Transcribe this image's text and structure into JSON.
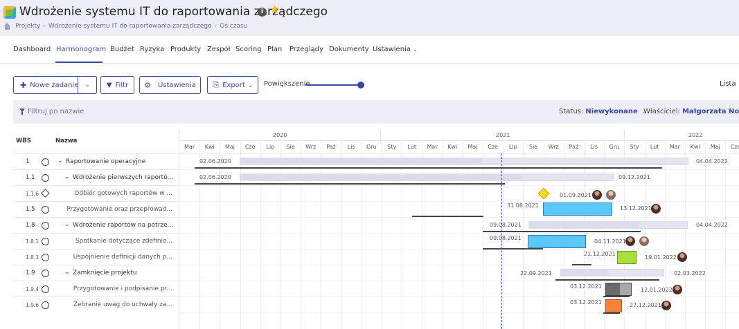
{
  "header": {
    "title": "Wdrożenie systemu IT do raportowania zarządczego",
    "breadcrumb": [
      "Projekty",
      "Wdrożenie systemu IT do raportowania zarządczego",
      "Oś czasu"
    ],
    "info_icon": "i"
  },
  "nav": {
    "items": [
      "Dashboard",
      "Harmonogram",
      "Budżet",
      "Ryzyka",
      "Produkty",
      "Zespół",
      "Scoring",
      "Plan",
      "Przeglądy",
      "Dokumenty",
      "Ustawienia"
    ],
    "active": "Harmonogram"
  },
  "toolbar": {
    "new_task": "Nowe zadanie",
    "filter": "Filtr",
    "settings": "Ustawienia",
    "export": "Export",
    "zoom_label": "Powiększenie",
    "zoom_level": 1.0,
    "list": "Lista"
  },
  "filterbar": {
    "placeholder": "Filtruj po nazwie",
    "status_label": "Status:",
    "status_value": "Niewykonane",
    "owner_label": "Właściciel:",
    "owner_value": "Małgorzata Nowak"
  },
  "grid": {
    "col_wbs": "WBS",
    "col_name": "Nazwa",
    "rows": [
      {
        "wbs": "1",
        "name": "Raportowanie operacyjne",
        "level": 0,
        "type": "group"
      },
      {
        "wbs": "1.1",
        "name": "Wdrożenie pierwszych raportó...",
        "level": 1,
        "type": "group"
      },
      {
        "wbs": "1.1.6",
        "name": "Odbiór gotowych raportów w ...",
        "level": 2,
        "type": "milestone"
      },
      {
        "wbs": "1.5",
        "name": "Przygotowanie oraz przeprowad...",
        "level": 2,
        "type": "task"
      },
      {
        "wbs": "1.8",
        "name": "Wdrożenie raportów na potrze...",
        "level": 1,
        "type": "group"
      },
      {
        "wbs": "1.8.1",
        "name": "Spotkanie dotyczące zdefinio...",
        "level": 2,
        "type": "task"
      },
      {
        "wbs": "1.8.3",
        "name": "Uspójnienie definicji danych p...",
        "level": 2,
        "type": "task"
      },
      {
        "wbs": "1.9",
        "name": "Zamknięcie projektu",
        "level": 1,
        "type": "group"
      },
      {
        "wbs": "1.9.4",
        "name": "Przygotowanie i podpisanie pr...",
        "level": 2,
        "type": "task"
      },
      {
        "wbs": "1.9.6",
        "name": "Zebranie uwag do uchwały za...",
        "level": 2,
        "type": "task"
      }
    ]
  },
  "timeline": {
    "years": [
      "2020",
      "2021",
      "2022"
    ],
    "months": [
      "Mar",
      "Kwi",
      "Maj",
      "Cze",
      "Lip",
      "Sie",
      "Wrz",
      "Paź",
      "Lis",
      "Gru",
      "Sty",
      "Lut",
      "Mar",
      "Kwi",
      "Maj",
      "Cze",
      "Lip",
      "Sie",
      "Wrz",
      "Paź",
      "Lis",
      "Gru",
      "Sty",
      "Lut",
      "Mar",
      "Kwi",
      "Maj",
      "Cze"
    ],
    "labels": {
      "r1_start": "02.06.2020",
      "r1_end": "04.04.2022",
      "r2_start": "02.06.2020",
      "r2_end": "09.12.2021",
      "r3_date": "01.09.2021",
      "r4_start": "31.08.2021",
      "r4_end": "13.12.2021",
      "r5_start": "09.08.2021",
      "r5_end": "04.04.2022",
      "r6_start": "09.08.2021",
      "r6_end": "04.11.2021",
      "r7_start": "21.12.2021",
      "r7_end": "19.01.2022",
      "r8_start": "22.09.2021",
      "r8_end": "02.03.2022",
      "r9_start": "03.12.2021",
      "r9_end": "12.01.2022",
      "r10_start": "03.12.2021",
      "r10_end": "27.12.2021"
    }
  },
  "colors": {
    "accent": "#3b4a9e",
    "task_blue": "#5ac8fa",
    "task_green": "#a8e03c",
    "task_grey": "#6b6b6b",
    "task_orange": "#f7823a",
    "milestone": "#f5dc1e",
    "star": "#f2b705"
  }
}
